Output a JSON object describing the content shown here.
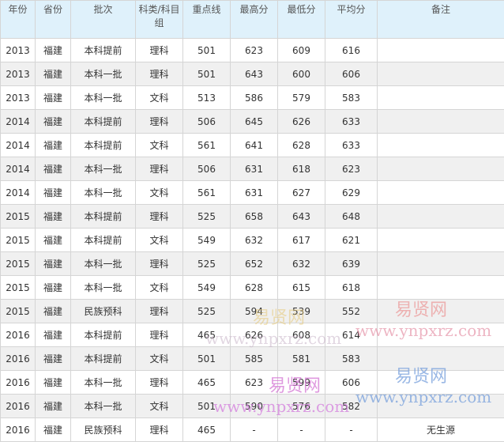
{
  "table": {
    "headers": [
      "年份",
      "省份",
      "批次",
      "科类/科目组",
      "重点线",
      "最高分",
      "最低分",
      "平均分",
      "备注"
    ],
    "rows": [
      [
        "2013",
        "福建",
        "本科提前",
        "理科",
        "501",
        "623",
        "609",
        "616",
        ""
      ],
      [
        "2013",
        "福建",
        "本科一批",
        "理科",
        "501",
        "643",
        "600",
        "606",
        ""
      ],
      [
        "2013",
        "福建",
        "本科一批",
        "文科",
        "513",
        "586",
        "579",
        "583",
        ""
      ],
      [
        "2014",
        "福建",
        "本科提前",
        "理科",
        "506",
        "645",
        "626",
        "633",
        ""
      ],
      [
        "2014",
        "福建",
        "本科提前",
        "文科",
        "561",
        "641",
        "628",
        "633",
        ""
      ],
      [
        "2014",
        "福建",
        "本科一批",
        "理科",
        "506",
        "631",
        "618",
        "623",
        ""
      ],
      [
        "2014",
        "福建",
        "本科一批",
        "文科",
        "561",
        "631",
        "627",
        "629",
        ""
      ],
      [
        "2015",
        "福建",
        "本科提前",
        "理科",
        "525",
        "658",
        "643",
        "648",
        ""
      ],
      [
        "2015",
        "福建",
        "本科提前",
        "文科",
        "549",
        "632",
        "617",
        "621",
        ""
      ],
      [
        "2015",
        "福建",
        "本科一批",
        "理科",
        "525",
        "652",
        "632",
        "639",
        ""
      ],
      [
        "2015",
        "福建",
        "本科一批",
        "文科",
        "549",
        "628",
        "615",
        "618",
        ""
      ],
      [
        "2015",
        "福建",
        "民族预科",
        "理科",
        "525",
        "594",
        "539",
        "552",
        ""
      ],
      [
        "2016",
        "福建",
        "本科提前",
        "理科",
        "465",
        "626",
        "608",
        "614",
        ""
      ],
      [
        "2016",
        "福建",
        "本科提前",
        "文科",
        "501",
        "585",
        "581",
        "583",
        ""
      ],
      [
        "2016",
        "福建",
        "本科一批",
        "理科",
        "465",
        "623",
        "599",
        "606",
        ""
      ],
      [
        "2016",
        "福建",
        "本科一批",
        "文科",
        "501",
        "590",
        "576",
        "582",
        ""
      ],
      [
        "2016",
        "福建",
        "民族预科",
        "理科",
        "465",
        "-",
        "-",
        "-",
        "无生源"
      ]
    ]
  },
  "watermarks": [
    {
      "cn": "易贤网",
      "url": "www.ynpxrz.com"
    },
    {
      "cn": "易贤网",
      "url": "www.ynpxrz.com"
    },
    {
      "cn": "易贤网",
      "url": "www.ynpxrz.com"
    },
    {
      "cn": "易贤网",
      "url": "www.ynpxrz.com"
    }
  ]
}
